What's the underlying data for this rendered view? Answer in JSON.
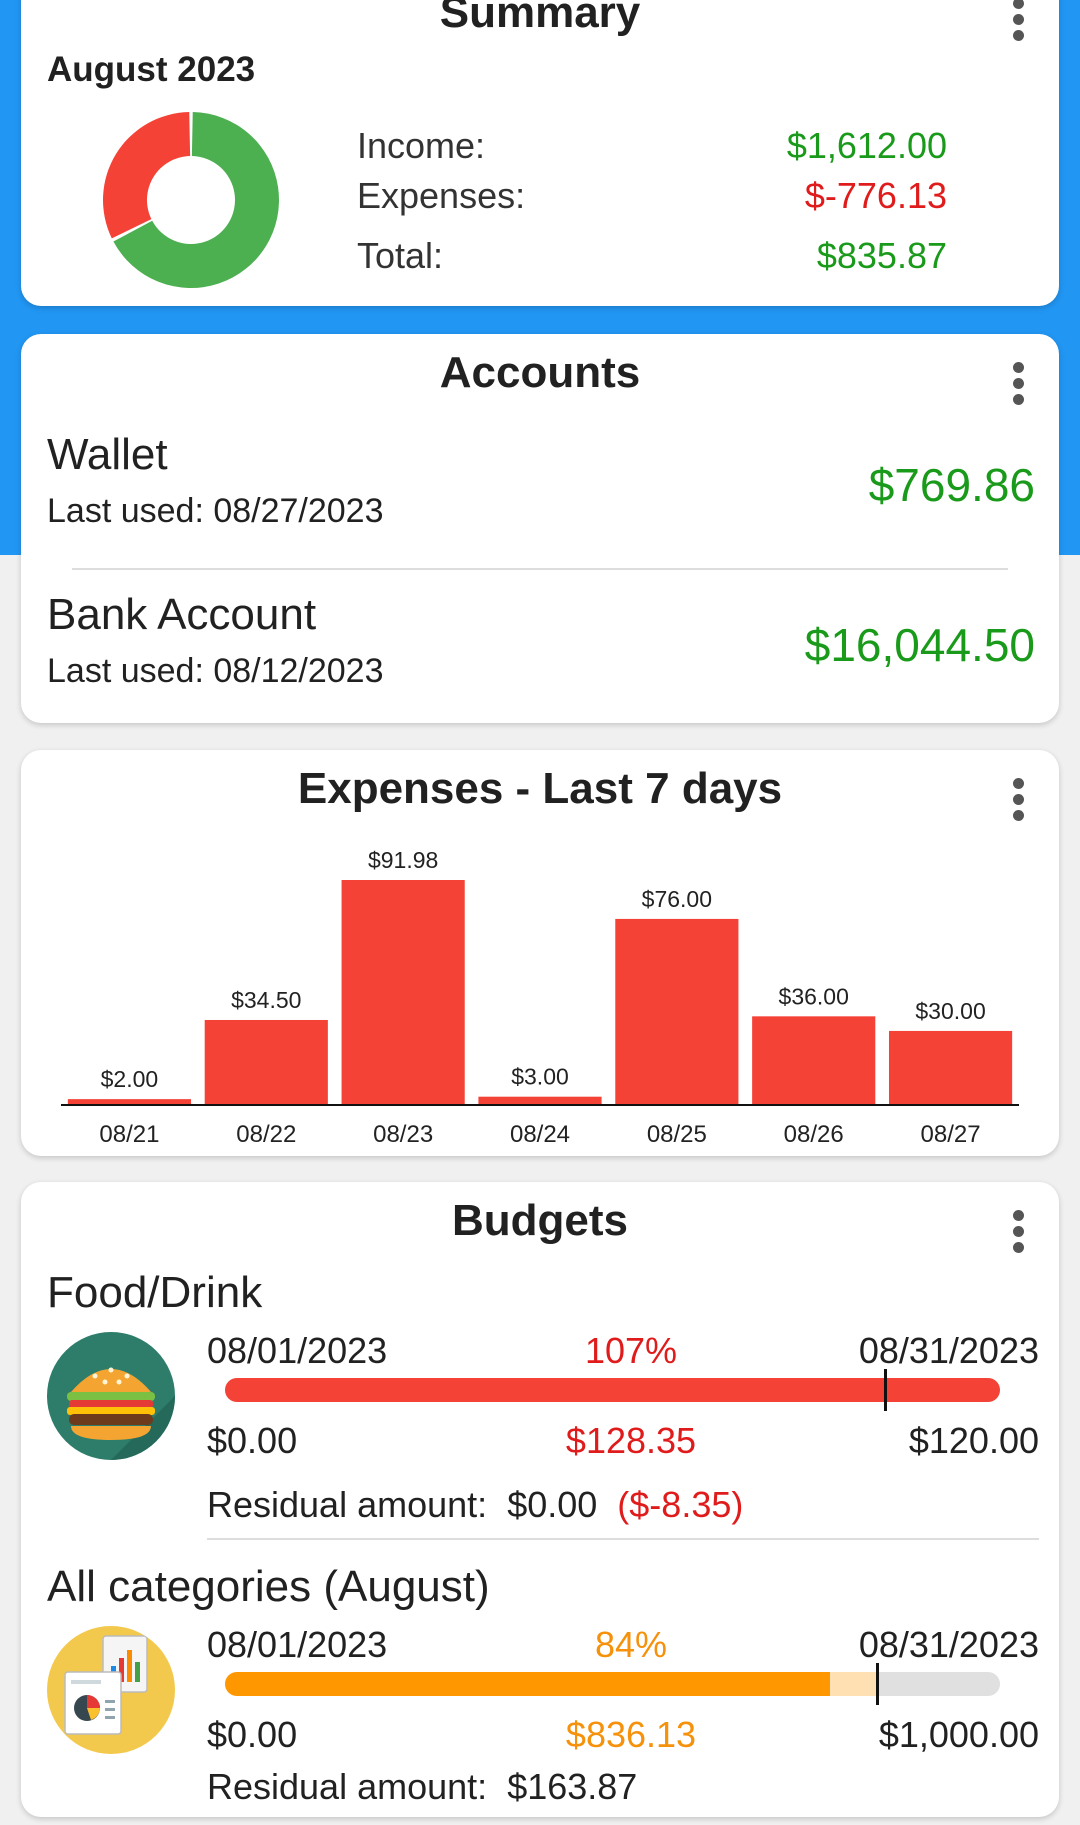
{
  "summary": {
    "title": "Summary",
    "month": "August 2023",
    "income_label": "Income:",
    "income_value": "$1,612.00",
    "expenses_label": "Expenses:",
    "expenses_value": "$-776.13",
    "total_label": "Total:",
    "total_value": "$835.87",
    "donut": {
      "income": 1612.0,
      "expenses": 776.13,
      "income_color": "#4caf50",
      "expense_color": "#f44336"
    }
  },
  "accounts": {
    "title": "Accounts",
    "items": [
      {
        "name": "Wallet",
        "last_used": "Last used: 08/27/2023",
        "balance": "$769.86"
      },
      {
        "name": "Bank Account",
        "last_used": "Last used: 08/12/2023",
        "balance": "$16,044.50"
      }
    ]
  },
  "expenses": {
    "title": "Expenses - Last 7 days"
  },
  "chart_data": {
    "type": "bar",
    "title": "Expenses - Last 7 days",
    "categories": [
      "08/21",
      "08/22",
      "08/23",
      "08/24",
      "08/25",
      "08/26",
      "08/27"
    ],
    "values": [
      2.0,
      34.5,
      91.98,
      3.0,
      76.0,
      36.0,
      30.0
    ],
    "value_labels": [
      "$2.00",
      "$34.50",
      "$91.98",
      "$3.00",
      "$76.00",
      "$36.00",
      "$30.00"
    ],
    "bar_color": "#f44336",
    "grid": false
  },
  "budgets": {
    "title": "Budgets",
    "items": [
      {
        "name": "Food/Drink",
        "icon": "burger-icon",
        "start_date": "08/01/2023",
        "end_date": "08/31/2023",
        "percent": "107%",
        "min": "$0.00",
        "spent": "$128.35",
        "max": "$120.00",
        "residual_label": "Residual amount:",
        "residual_value": "$0.00",
        "residual_over": "($-8.35)",
        "progress_fraction": 1.0,
        "marker_fraction": 0.85,
        "fill_color": "#f44336",
        "accent": "#e01b1b"
      },
      {
        "name": "All categories (August)",
        "icon": "report-icon",
        "start_date": "08/01/2023",
        "end_date": "08/31/2023",
        "percent": "84%",
        "min": "$0.00",
        "spent": "$836.13",
        "max": "$1,000.00",
        "residual_label": "Residual amount:",
        "residual_value": "$163.87",
        "progress_fraction": 0.78,
        "projected_fraction": 0.84,
        "fill_color": "#ff9800",
        "projected_color": "#ffe0b2",
        "accent": "#f5910a"
      }
    ]
  }
}
